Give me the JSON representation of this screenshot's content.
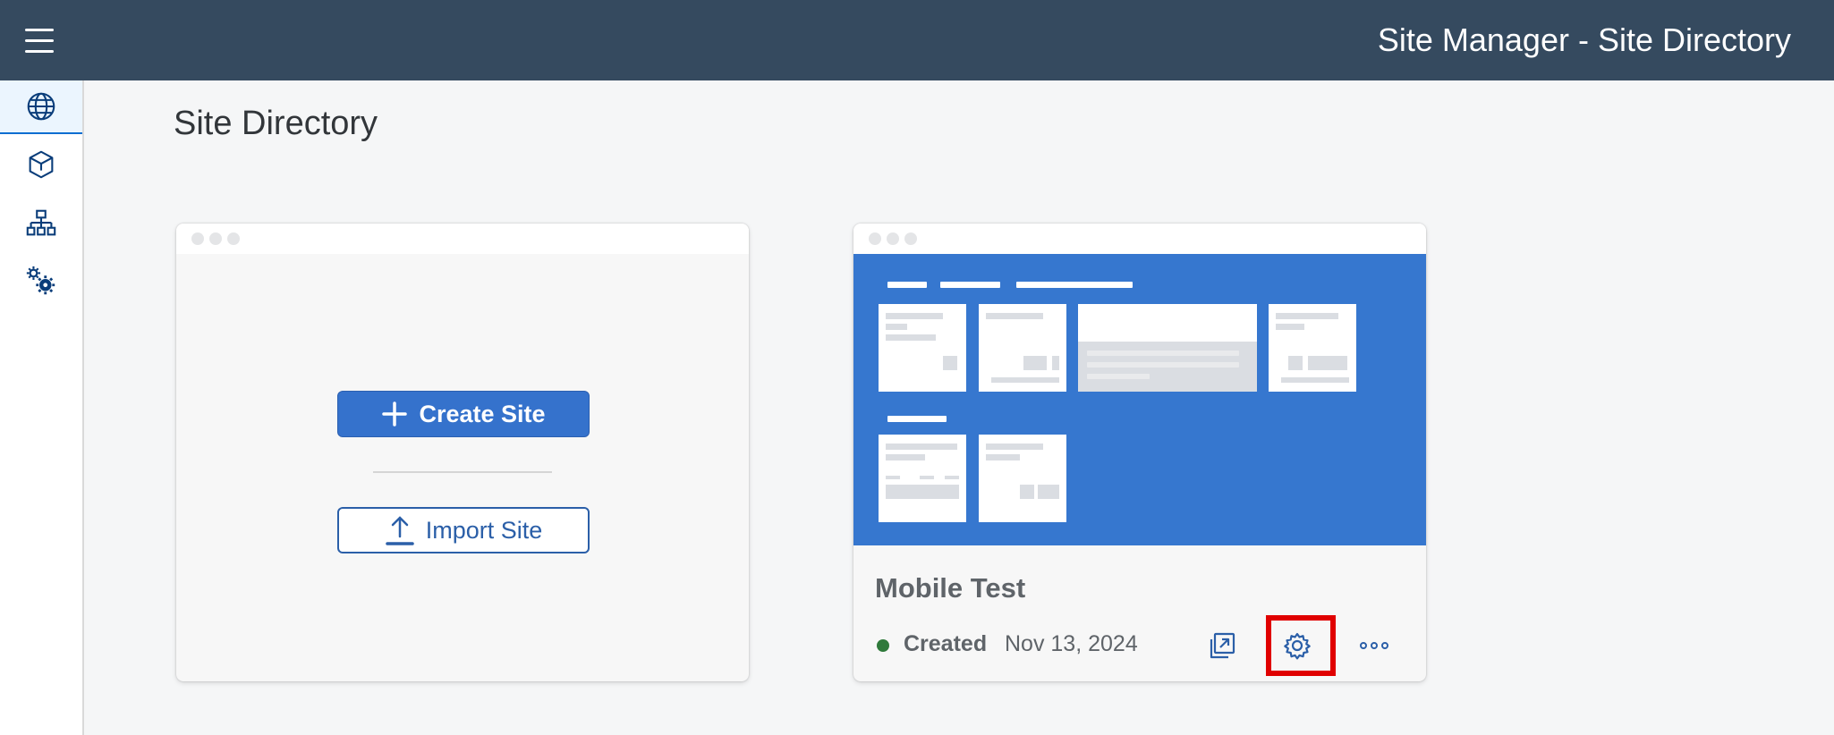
{
  "shell": {
    "title": "Site Manager - Site Directory",
    "background_color": "#354a5f"
  },
  "side_nav": {
    "items": [
      {
        "name": "Site Directory",
        "icon": "globe-icon",
        "active": true
      },
      {
        "name": "Content",
        "icon": "cube-icon",
        "active": false
      },
      {
        "name": "Hierarchy",
        "icon": "org-chart-icon",
        "active": false
      },
      {
        "name": "Settings",
        "icon": "gears-icon",
        "active": false
      }
    ]
  },
  "page": {
    "title": "Site Directory"
  },
  "new_site_card": {
    "create_label": "Create Site",
    "import_label": "Import Site",
    "create_icon": "plus-icon",
    "import_icon": "upload-icon",
    "accent_color": "#3572cc"
  },
  "site_card": {
    "name": "Mobile Test",
    "status": "Created",
    "status_color": "#2f7a3b",
    "date": "Nov 13, 2024",
    "preview_color": "#3677cf",
    "actions": [
      {
        "icon": "open-in-new-window-icon"
      },
      {
        "icon": "settings-icon",
        "highlighted": true
      },
      {
        "icon": "more-icon"
      }
    ]
  }
}
